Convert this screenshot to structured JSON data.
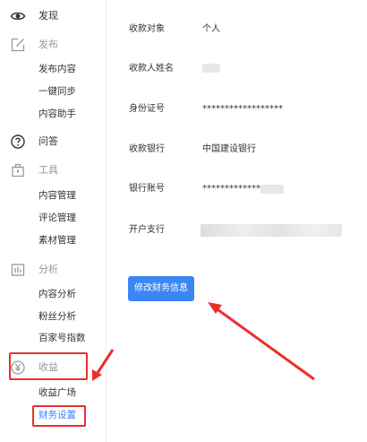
{
  "sidebar": {
    "discover": {
      "label": "发现",
      "icon": "eye-icon"
    },
    "publish": {
      "label": "发布",
      "icon": "edit-icon",
      "items": [
        {
          "label": "发布内容"
        },
        {
          "label": "一键同步"
        },
        {
          "label": "内容助手"
        }
      ]
    },
    "qa": {
      "label": "问答",
      "icon": "question-icon"
    },
    "tools": {
      "label": "工具",
      "icon": "toolbox-icon",
      "items": [
        {
          "label": "内容管理"
        },
        {
          "label": "评论管理"
        },
        {
          "label": "素材管理"
        }
      ]
    },
    "analytics": {
      "label": "分析",
      "icon": "chart-icon",
      "items": [
        {
          "label": "内容分析"
        },
        {
          "label": "粉丝分析"
        },
        {
          "label": "百家号指数"
        }
      ]
    },
    "income": {
      "label": "收益",
      "icon": "yuan-coin-icon",
      "items": [
        {
          "label": "收益广场"
        },
        {
          "label": "财务设置",
          "active": true
        }
      ]
    }
  },
  "finance": {
    "fields": [
      {
        "label": "收款对象",
        "value": "个人"
      },
      {
        "label": "收款人姓名",
        "value": ""
      },
      {
        "label": "身份证号",
        "value": "******************"
      },
      {
        "label": "收款银行",
        "value": "中国建设银行"
      },
      {
        "label": "银行账号",
        "value": "**************"
      },
      {
        "label": "开户支行",
        "value": ""
      }
    ],
    "edit_button": "修改财务信息"
  },
  "colors": {
    "accent": "#3b86f5",
    "highlight": "#e8302a",
    "active_text": "#3b7cff"
  }
}
